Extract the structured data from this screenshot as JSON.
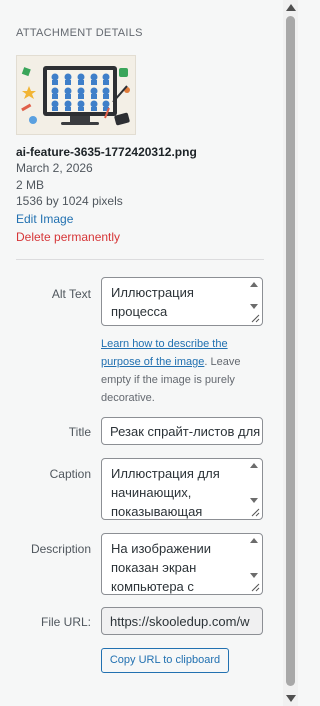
{
  "section_title": "ATTACHMENT DETAILS",
  "file": {
    "name": "ai-feature-3635-1772420312.png",
    "date": "March 2, 2026",
    "size": "2 MB",
    "dimensions": "1536 by 1024 pixels",
    "edit_link": "Edit Image",
    "delete_link": "Delete permanently"
  },
  "fields": {
    "alt_text": {
      "label": "Alt Text",
      "value": "Иллюстрация процесса"
    },
    "help": {
      "link": "Learn how to describe the purpose of the image",
      "rest": ". Leave empty if the image is purely decorative."
    },
    "title": {
      "label": "Title",
      "value": "Резак спрайт-листов для"
    },
    "caption": {
      "label": "Caption",
      "value": "Иллюстрация для начинающих, показывающая"
    },
    "description": {
      "label": "Description",
      "value": "На изображении показан экран компьютера с"
    },
    "file_url": {
      "label": "File URL:",
      "value": "https://skooledup.com/w"
    }
  },
  "copy_button": "Copy URL to clipboard",
  "colors": {
    "link": "#2271b1",
    "delete": "#d63638",
    "panel_bg": "#f6f7f7"
  }
}
